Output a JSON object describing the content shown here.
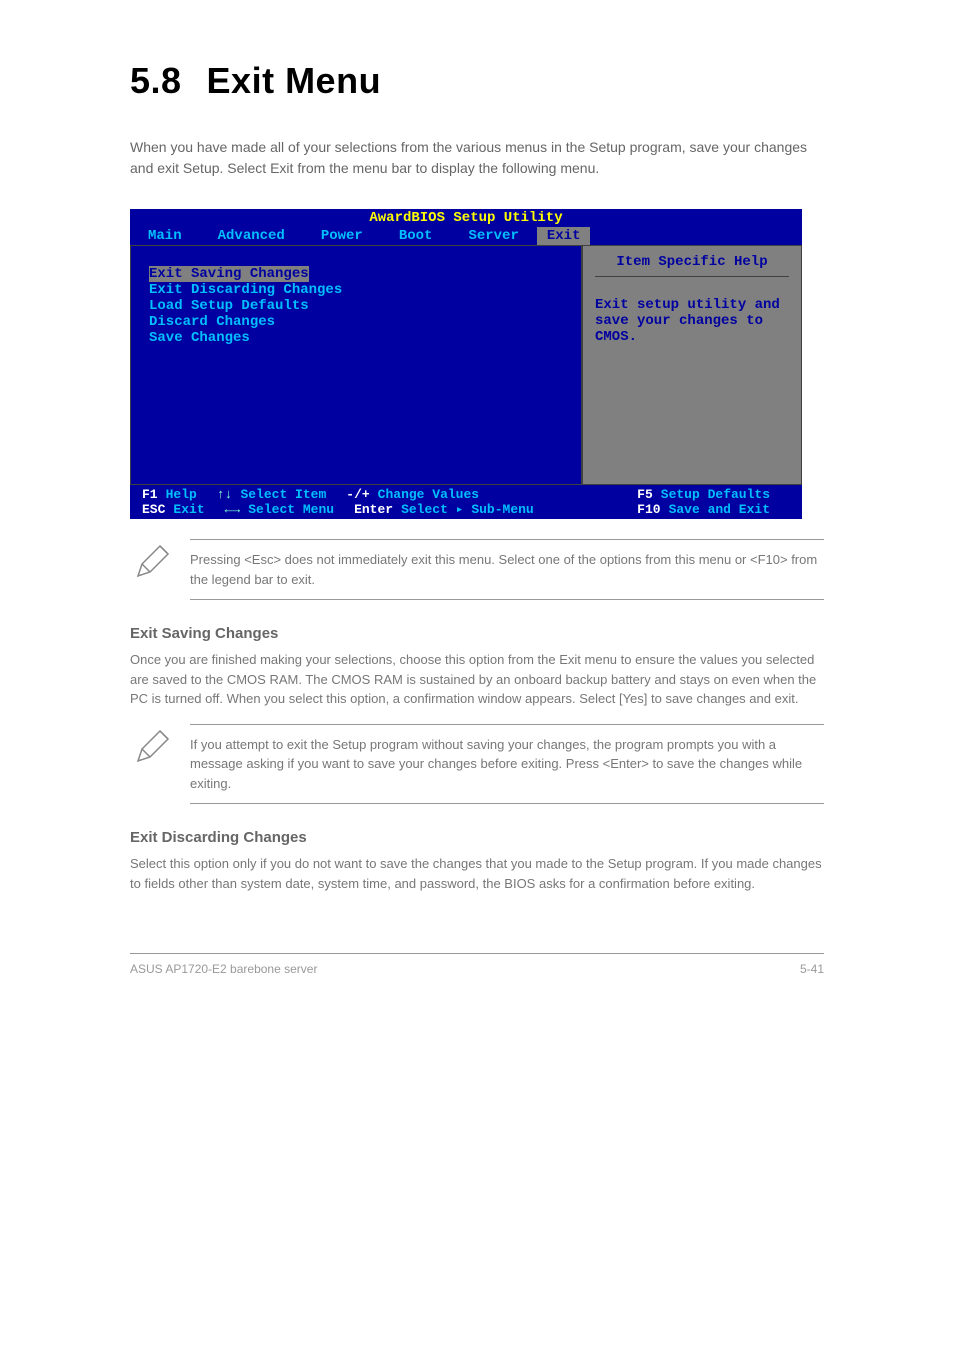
{
  "page": {
    "section_number": "5.8",
    "section_title": "Exit Menu",
    "intro": "When you have made all of your selections from the various menus in the Setup program, save your changes and exit Setup. Select Exit from the menu bar to display the following menu."
  },
  "bios": {
    "utility_title": "AwardBIOS Setup Utility",
    "tabs": {
      "main": "Main",
      "advanced": "Advanced",
      "power": "Power",
      "boot": "Boot",
      "server": "Server",
      "exit": "Exit"
    },
    "options": {
      "exit_saving": "Exit Saving Changes",
      "exit_discarding": "Exit Discarding Changes",
      "load_defaults": "Load Setup Defaults",
      "discard_changes": "Discard Changes",
      "save_changes": "Save Changes"
    },
    "help": {
      "title": "Item Specific Help",
      "text": "Exit setup utility and save your changes to CMOS."
    },
    "footer": {
      "f1": "F1",
      "esc": "ESC",
      "help": "Help",
      "exit": "Exit",
      "updown": "↑↓",
      "leftright": "←→",
      "select_item": "Select Item",
      "select_menu": "Select Menu",
      "minusplus": "-/+",
      "enter": "Enter",
      "change_values": "Change Values",
      "select_submenu": "Select ▸ Sub-Menu",
      "f5": "F5",
      "f10": "F10",
      "setup_defaults": "Setup Defaults",
      "save_exit": "Save and Exit"
    }
  },
  "notes": {
    "note1": "Pressing <Esc> does not immediately exit this menu. Select one of the options from this menu or <F10> from the legend bar to exit.",
    "note2": "If you attempt to exit the Setup program without saving your changes, the program prompts you with a message asking if you want to save your changes before exiting. Press <Enter> to save the changes while exiting."
  },
  "sections": {
    "exit_saving_title": "Exit Saving Changes",
    "exit_saving_text": "Once you are finished making your selections, choose this option from the Exit menu to ensure the values you selected are saved to the CMOS RAM. The CMOS RAM is sustained by an onboard backup battery and stays on even when the PC is turned off. When you select this option, a confirmation window appears. Select [Yes] to save changes and exit.",
    "exit_discarding_title": "Exit Discarding Changes",
    "exit_discarding_text": "Select this option only if you do not want to save the changes that you made to the Setup program. If you made changes to fields other than system date, system time, and password, the BIOS asks for a confirmation before exiting."
  },
  "footer": {
    "left": "ASUS AP1720-E2 barebone server",
    "right": "5-41"
  }
}
